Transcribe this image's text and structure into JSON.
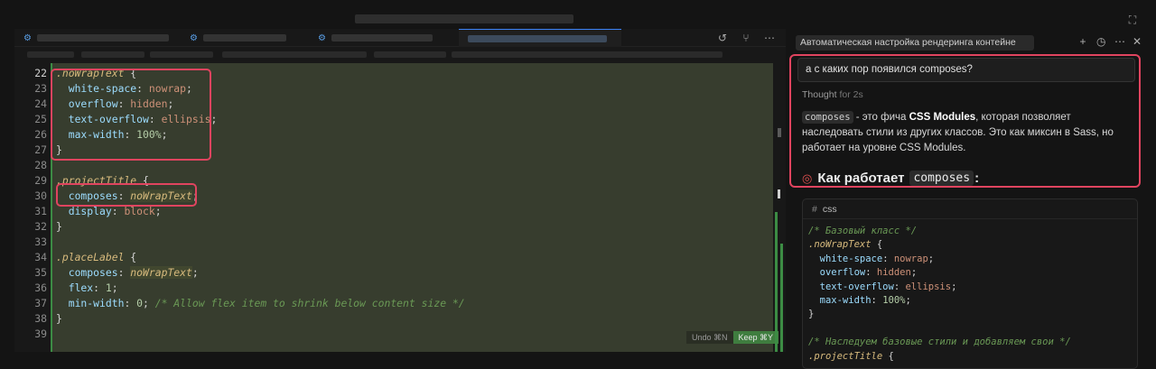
{
  "window": {
    "top_right_icon": "layout-icon"
  },
  "editor": {
    "actions": [
      "history-icon",
      "source-control-icon",
      "more-icon"
    ],
    "lines": [
      {
        "n": "22",
        "parts": [
          [
            "sel",
            ".noWrapText"
          ],
          [
            "punc",
            " {"
          ]
        ]
      },
      {
        "n": "23",
        "parts": [
          [
            "prop",
            "  white-space"
          ],
          [
            "punc",
            ": "
          ],
          [
            "val",
            "nowrap"
          ],
          [
            "punc",
            ";"
          ]
        ]
      },
      {
        "n": "24",
        "parts": [
          [
            "prop",
            "  overflow"
          ],
          [
            "punc",
            ": "
          ],
          [
            "val",
            "hidden"
          ],
          [
            "punc",
            ";"
          ]
        ]
      },
      {
        "n": "25",
        "parts": [
          [
            "prop",
            "  text-overflow"
          ],
          [
            "punc",
            ": "
          ],
          [
            "val",
            "ellipsis"
          ],
          [
            "punc",
            ";"
          ]
        ]
      },
      {
        "n": "26",
        "parts": [
          [
            "prop",
            "  max-width"
          ],
          [
            "punc",
            ": "
          ],
          [
            "num",
            "100%"
          ],
          [
            "punc",
            ";"
          ]
        ]
      },
      {
        "n": "27",
        "parts": [
          [
            "punc",
            "}"
          ]
        ]
      },
      {
        "n": "28",
        "parts": []
      },
      {
        "n": "29",
        "parts": [
          [
            "sel",
            ".projectTitle"
          ],
          [
            "punc",
            " {"
          ]
        ]
      },
      {
        "n": "30",
        "parts": [
          [
            "prop",
            "  composes"
          ],
          [
            "punc",
            ": "
          ],
          [
            "ident",
            "noWrapText"
          ],
          [
            "punc",
            ";"
          ]
        ]
      },
      {
        "n": "31",
        "parts": [
          [
            "prop",
            "  display"
          ],
          [
            "punc",
            ": "
          ],
          [
            "val",
            "block"
          ],
          [
            "punc",
            ";"
          ]
        ]
      },
      {
        "n": "32",
        "parts": [
          [
            "punc",
            "}"
          ]
        ]
      },
      {
        "n": "33",
        "parts": []
      },
      {
        "n": "34",
        "parts": [
          [
            "sel",
            ".placeLabel"
          ],
          [
            "punc",
            " {"
          ]
        ]
      },
      {
        "n": "35",
        "parts": [
          [
            "prop",
            "  composes"
          ],
          [
            "punc",
            ": "
          ],
          [
            "ident",
            "noWrapText"
          ],
          [
            "punc",
            ";"
          ]
        ]
      },
      {
        "n": "36",
        "parts": [
          [
            "prop",
            "  flex"
          ],
          [
            "punc",
            ": "
          ],
          [
            "num",
            "1"
          ],
          [
            "punc",
            ";"
          ]
        ]
      },
      {
        "n": "37",
        "parts": [
          [
            "prop",
            "  min-width"
          ],
          [
            "punc",
            ": "
          ],
          [
            "num",
            "0"
          ],
          [
            "punc",
            "; "
          ],
          [
            "comment",
            "/* Allow flex item to shrink below content size */"
          ]
        ]
      },
      {
        "n": "38",
        "parts": [
          [
            "punc",
            "}"
          ]
        ]
      },
      {
        "n": "39",
        "parts": []
      }
    ],
    "undo_label": "Undo ⌘N",
    "keep_label": "Keep ⌘Y"
  },
  "chat": {
    "tab_title": "Автоматическая настройка рендеринга контейне",
    "header_actions": [
      "plus-icon",
      "history-icon",
      "more-icon",
      "close-icon"
    ],
    "question": "а с каких пор появился composes?",
    "thought_label": "Thought",
    "thought_time": "for 2s",
    "answer_code": "composes",
    "answer_text_1": " - это фича ",
    "answer_bold": "CSS Modules",
    "answer_text_2": ", которая позволяет наследовать стили из других классов. Это как миксин в Sass, но работает на уровне CSS Modules.",
    "how_heading_prefix": "Как работает",
    "how_heading_code": "composes",
    "how_heading_suffix": ":",
    "code_lang": "css",
    "code_lines": [
      [
        [
          "comment",
          "/* Базовый класс */"
        ]
      ],
      [
        [
          "sel",
          ".noWrapText"
        ],
        [
          "punc",
          " {"
        ]
      ],
      [
        [
          "prop",
          "  white-space"
        ],
        [
          "punc",
          ": "
        ],
        [
          "val",
          "nowrap"
        ],
        [
          "punc",
          ";"
        ]
      ],
      [
        [
          "prop",
          "  overflow"
        ],
        [
          "punc",
          ": "
        ],
        [
          "val",
          "hidden"
        ],
        [
          "punc",
          ";"
        ]
      ],
      [
        [
          "prop",
          "  text-overflow"
        ],
        [
          "punc",
          ": "
        ],
        [
          "val",
          "ellipsis"
        ],
        [
          "punc",
          ";"
        ]
      ],
      [
        [
          "prop",
          "  max-width"
        ],
        [
          "punc",
          ": "
        ],
        [
          "num",
          "100%"
        ],
        [
          "punc",
          ";"
        ]
      ],
      [
        [
          "punc",
          "}"
        ]
      ],
      [],
      [
        [
          "comment",
          "/* Наследуем базовые стили и добавляем свои */"
        ]
      ],
      [
        [
          "sel",
          ".projectTitle"
        ],
        [
          "punc",
          " {"
        ]
      ]
    ]
  }
}
